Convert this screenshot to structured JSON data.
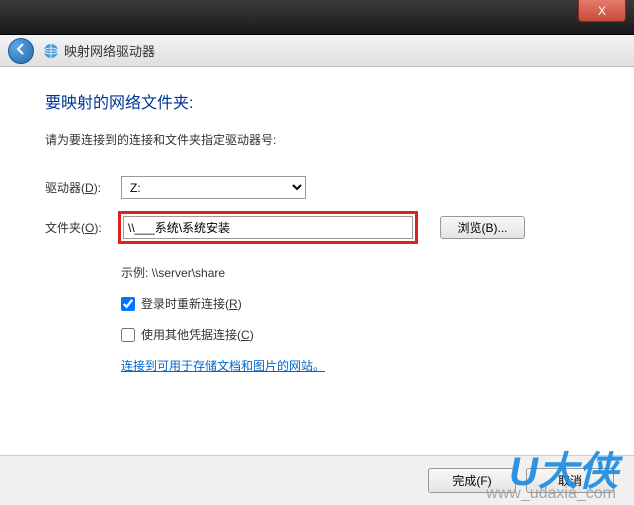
{
  "titlebar": {
    "close_label": "X"
  },
  "nav": {
    "title": "映射网络驱动器"
  },
  "header": {
    "heading": "要映射的网络文件夹:",
    "subtext": "请为要连接到的连接和文件夹指定驱动器号:"
  },
  "form": {
    "drive_label": "驱动器",
    "drive_accel": "D",
    "drive_value": "Z:",
    "folder_label": "文件夹",
    "folder_accel": "O",
    "folder_value": "\\\\___系统\\系统安装",
    "browse_label": "浏览(B)...",
    "example_label": "示例:",
    "example_value": "\\\\server\\share",
    "reconnect_label": "登录时重新连接",
    "reconnect_accel": "R",
    "credentials_label": "使用其他凭据连接",
    "credentials_accel": "C",
    "link_storage": "连接到可用于存储文档和图片的网站。"
  },
  "buttons": {
    "finish": "完成(F)",
    "cancel": "取消"
  },
  "watermark": {
    "logo": "U大侠",
    "url": "www_udaxia_com"
  }
}
